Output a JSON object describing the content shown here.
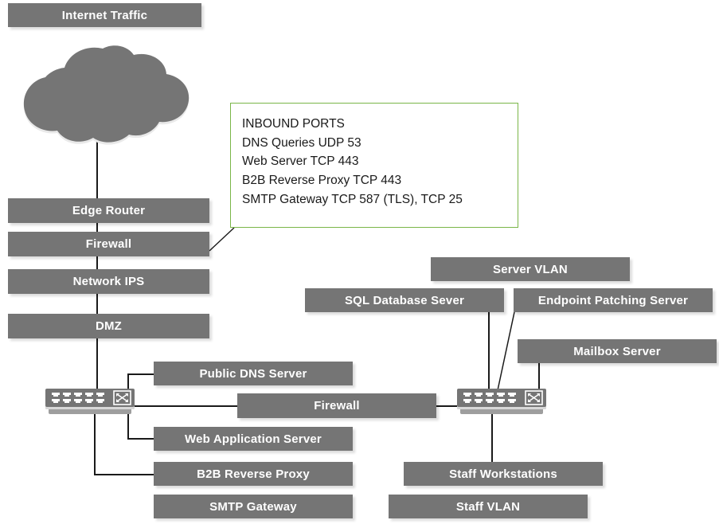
{
  "diagram": {
    "title_box": {
      "label": "Internet Traffic"
    },
    "cloud": {
      "name": "internet-cloud"
    },
    "ports_callout": {
      "heading": "INBOUND PORTS",
      "lines": [
        "DNS Queries UDP 53",
        "Web Server TCP 443",
        "B2B Reverse Proxy TCP 443",
        "SMTP Gateway TCP 587 (TLS), TCP 25"
      ],
      "border_color": "#7ab648"
    },
    "perimeter_chain": [
      {
        "label": "Edge Router"
      },
      {
        "label": "Firewall"
      },
      {
        "label": "Network IPS"
      },
      {
        "label": "DMZ"
      }
    ],
    "dmz_services": [
      {
        "label": "Public DNS Server"
      },
      {
        "label": "Web Application Server"
      },
      {
        "label": "B2B Reverse Proxy"
      },
      {
        "label": "SMTP Gateway"
      }
    ],
    "internal_firewall": {
      "label": "Firewall"
    },
    "server_zone": [
      {
        "label": "Server VLAN"
      },
      {
        "label": "SQL Database Sever"
      },
      {
        "label": "Endpoint Patching Server"
      },
      {
        "label": "Mailbox Server"
      }
    ],
    "staff_zone": [
      {
        "label": "Staff Workstations"
      },
      {
        "label": "Staff VLAN"
      }
    ],
    "switches": [
      {
        "name": "dmz-switch",
        "icon": "network-switch-icon"
      },
      {
        "name": "internal-switch",
        "icon": "network-switch-icon"
      }
    ],
    "colors": {
      "node_fill": "#757575",
      "node_text": "#ffffff",
      "callout_border": "#7ab648",
      "line": "#1a1a1a",
      "background": "#ffffff"
    }
  }
}
